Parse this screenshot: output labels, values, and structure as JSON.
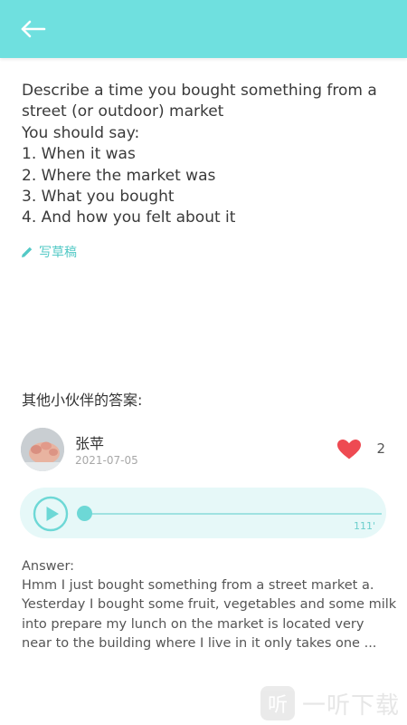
{
  "header": {
    "back_icon": "arrow-left-icon",
    "bg_color": "#6fe0df"
  },
  "question": {
    "lines": [
      "Describe a time you bought something from a",
      "street (or outdoor) market",
      "You should say:",
      "1. When it was",
      "2. Where the market was",
      "3. What you bought",
      "4. And how you felt about it"
    ]
  },
  "draft": {
    "icon": "pencil-icon",
    "label": "写草稿"
  },
  "others": {
    "title": "其他小伙伴的答案:"
  },
  "answer_card": {
    "user": {
      "name": "张苹",
      "date": "2021-07-05"
    },
    "likes": {
      "icon": "heart-icon",
      "count": "2"
    },
    "audio": {
      "duration": "111'",
      "progress": 0
    },
    "answer": {
      "label": "Answer:",
      "lines": [
        "Hmm I just bought something from a street market a.",
        "Yesterday I bought some fruit, vegetables and some milk",
        "into prepare my lunch on the market is located very",
        "near to the building where I live in it only takes one ..."
      ]
    }
  },
  "watermark": {
    "box_glyph": "听",
    "text": "一听下载"
  },
  "colors": {
    "accent": "#6dd8d6",
    "heart": "#ee4a52"
  }
}
